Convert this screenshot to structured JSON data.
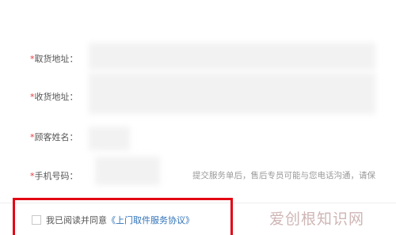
{
  "form": {
    "pickup_address": {
      "required_mark": "*",
      "label": "取货地址："
    },
    "delivery_address": {
      "required_mark": "*",
      "label": "收货地址："
    },
    "customer_name": {
      "required_mark": "*",
      "label": "顾客姓名："
    },
    "phone": {
      "required_mark": "*",
      "label": "手机号码：",
      "hint": "提交服务单后，售后专员可能与您电话沟通，请保"
    }
  },
  "agreement": {
    "text": "我已阅读并同意",
    "link_text": "《上门取件服务协议》",
    "checked": false
  },
  "watermark": {
    "text": "爱创根知识网"
  },
  "colors": {
    "required": "#e4393c",
    "link": "#2f72b8",
    "highlight_border": "#e30613"
  }
}
